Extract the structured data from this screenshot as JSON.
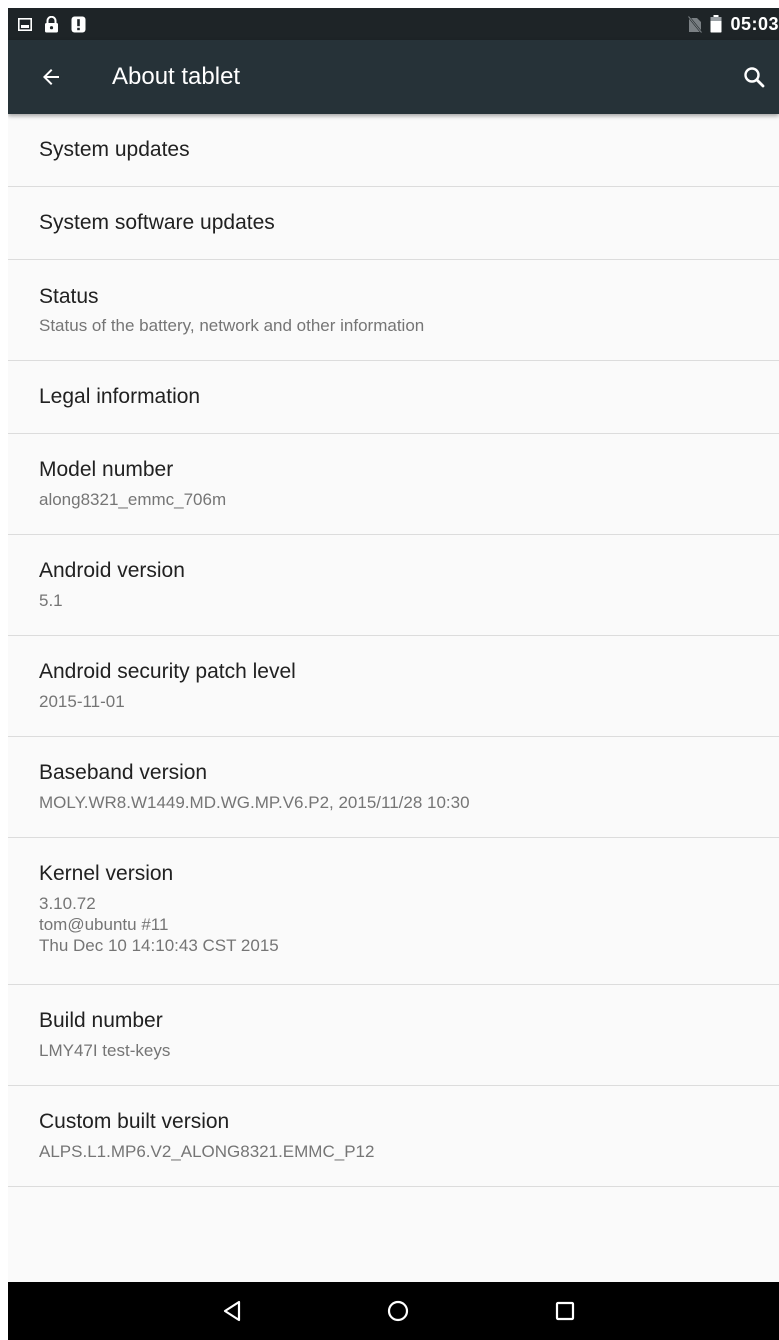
{
  "status_bar": {
    "left_icons": [
      "image-notification-icon",
      "lock-icon",
      "alert-icon"
    ],
    "right_icons": [
      "no-sim-icon",
      "battery-icon"
    ],
    "time": "05:03"
  },
  "app_bar": {
    "back_icon": "arrow-left-icon",
    "title": "About tablet",
    "search_icon": "search-icon"
  },
  "items": [
    {
      "title": "System updates"
    },
    {
      "title": "System software updates"
    },
    {
      "title": "Status",
      "subtitle": "Status of the battery, network and other information"
    },
    {
      "title": "Legal information"
    },
    {
      "title": "Model number",
      "subtitle": "along8321_emmc_706m"
    },
    {
      "title": "Android version",
      "subtitle": "5.1"
    },
    {
      "title": "Android security patch level",
      "subtitle": "2015-11-01"
    },
    {
      "title": "Baseband version",
      "subtitle": "MOLY.WR8.W1449.MD.WG.MP.V6.P2, 2015/11/28 10:30"
    },
    {
      "title": "Kernel version",
      "subtitle": "3.10.72\ntom@ubuntu #11\nThu Dec 10 14:10:43 CST 2015"
    },
    {
      "title": "Build number",
      "subtitle": "LMY47I test-keys"
    },
    {
      "title": "Custom built version",
      "subtitle": "ALPS.L1.MP6.V2_ALONG8321.EMMC_P12"
    }
  ],
  "nav_bar": {
    "buttons": [
      "back-triangle-icon",
      "home-circle-icon",
      "recents-square-icon"
    ]
  }
}
